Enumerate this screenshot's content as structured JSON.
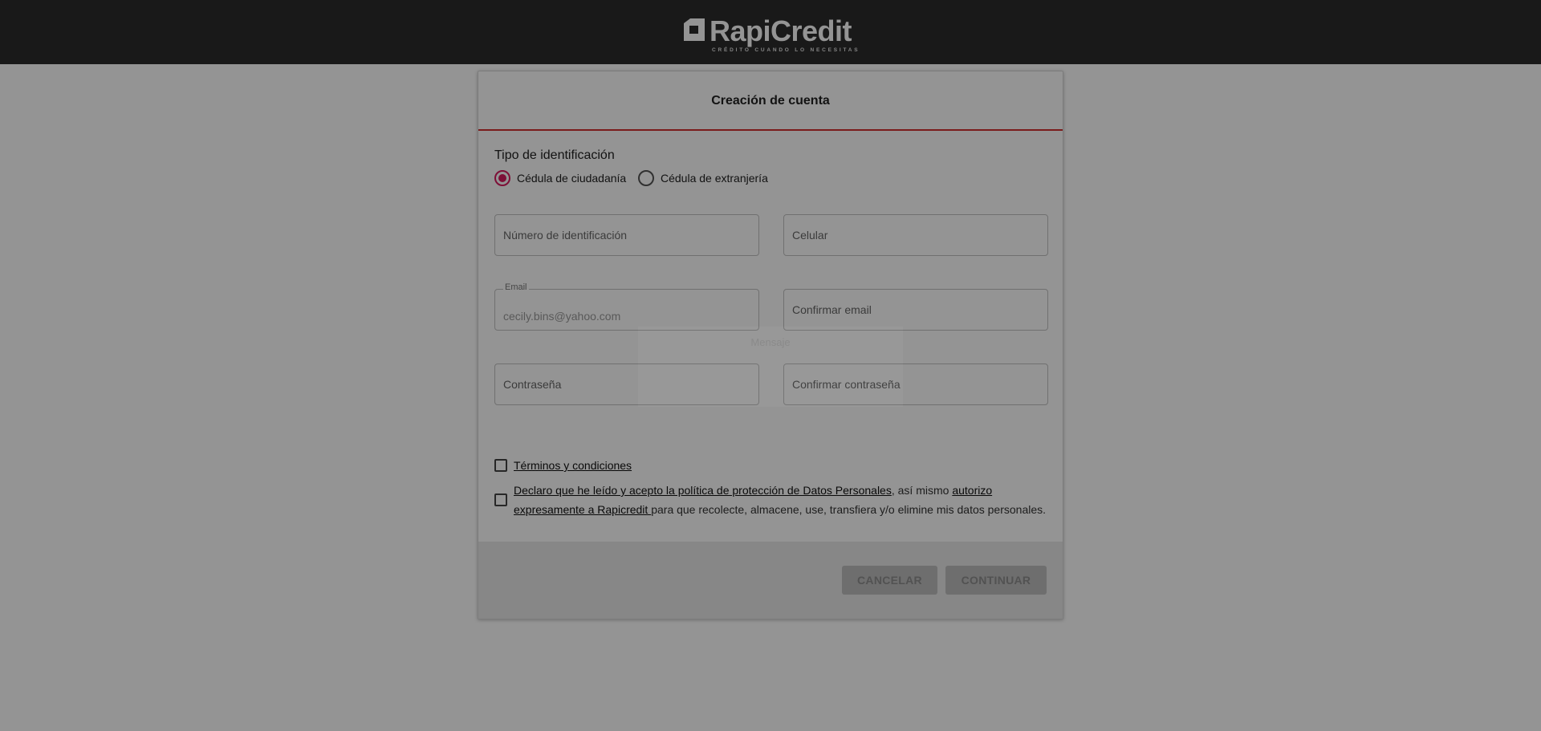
{
  "brand": {
    "name": "RapiCredit",
    "tagline": "CRÉDITO CUANDO LO NECESITAS"
  },
  "form": {
    "title": "Creación de cuenta",
    "id_type_label": "Tipo de identificación",
    "id_type_options": [
      {
        "label": "Cédula de ciudadanía",
        "selected": true
      },
      {
        "label": "Cédula de extranjería",
        "selected": false
      }
    ],
    "fields": {
      "id_number": {
        "placeholder": "Número de identificación",
        "value": ""
      },
      "phone": {
        "placeholder": "Celular",
        "value": ""
      },
      "email": {
        "label": "Email",
        "value": "cecily.bins@yahoo.com"
      },
      "confirm_email": {
        "placeholder": "Confirmar email",
        "value": ""
      },
      "password": {
        "placeholder": "Contraseña",
        "value": ""
      },
      "confirm_password": {
        "placeholder": "Confirmar contraseña",
        "value": ""
      }
    },
    "terms": {
      "link": " Términos y condiciones "
    },
    "privacy": {
      "link1": " Declaro que he leído y acepto la política de protección de Datos Personales",
      "mid": ", así mismo ",
      "link2": "autorizo expresamente a Rapicredit ",
      "rest": "para que recolecte, almacene, use, transfiera y/o elimine mis datos personales."
    },
    "buttons": {
      "cancel": "CANCELAR",
      "continue": "CONTINUAR"
    }
  },
  "loading": {
    "text": "Mensaje"
  },
  "colors": {
    "accent": "#d32f2f",
    "radio": "#d81b60",
    "header_bg": "#2b2b2b",
    "overlay": "rgba(0,0,0,0.42)"
  }
}
